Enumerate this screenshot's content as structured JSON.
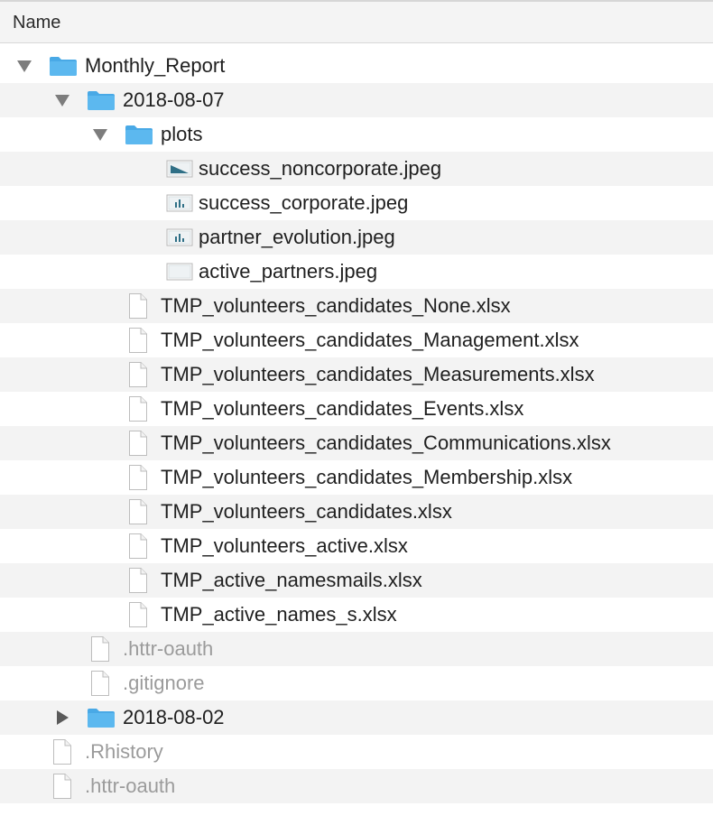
{
  "header": {
    "column_name": "Name"
  },
  "tree": {
    "rows": [
      {
        "label": "Monthly_Report",
        "kind": "folder",
        "depth": 0,
        "expanded": true,
        "icon": "folder-icon",
        "dim": false
      },
      {
        "label": "2018-08-07",
        "kind": "folder",
        "depth": 1,
        "expanded": true,
        "icon": "folder-icon",
        "dim": false
      },
      {
        "label": "plots",
        "kind": "folder",
        "depth": 2,
        "expanded": true,
        "icon": "folder-icon",
        "dim": false
      },
      {
        "label": "success_noncorporate.jpeg",
        "kind": "image",
        "depth": 3,
        "icon": "image-thumbnail-icon",
        "dim": false
      },
      {
        "label": "success_corporate.jpeg",
        "kind": "image",
        "depth": 3,
        "icon": "image-thumbnail-icon",
        "dim": false
      },
      {
        "label": "partner_evolution.jpeg",
        "kind": "image",
        "depth": 3,
        "icon": "image-thumbnail-icon",
        "dim": false
      },
      {
        "label": "active_partners.jpeg",
        "kind": "image",
        "depth": 3,
        "icon": "image-thumbnail-icon",
        "dim": false
      },
      {
        "label": "TMP_volunteers_candidates_None.xlsx",
        "kind": "file",
        "depth": 2,
        "icon": "document-icon",
        "dim": false
      },
      {
        "label": "TMP_volunteers_candidates_Management.xlsx",
        "kind": "file",
        "depth": 2,
        "icon": "document-icon",
        "dim": false
      },
      {
        "label": "TMP_volunteers_candidates_Measurements.xlsx",
        "kind": "file",
        "depth": 2,
        "icon": "document-icon",
        "dim": false
      },
      {
        "label": "TMP_volunteers_candidates_Events.xlsx",
        "kind": "file",
        "depth": 2,
        "icon": "document-icon",
        "dim": false
      },
      {
        "label": "TMP_volunteers_candidates_Communications.xlsx",
        "kind": "file",
        "depth": 2,
        "icon": "document-icon",
        "dim": false
      },
      {
        "label": "TMP_volunteers_candidates_Membership.xlsx",
        "kind": "file",
        "depth": 2,
        "icon": "document-icon",
        "dim": false
      },
      {
        "label": "TMP_volunteers_candidates.xlsx",
        "kind": "file",
        "depth": 2,
        "icon": "document-icon",
        "dim": false
      },
      {
        "label": "TMP_volunteers_active.xlsx",
        "kind": "file",
        "depth": 2,
        "icon": "document-icon",
        "dim": false
      },
      {
        "label": "TMP_active_namesmails.xlsx",
        "kind": "file",
        "depth": 2,
        "icon": "document-icon",
        "dim": false
      },
      {
        "label": "TMP_active_names_s.xlsx",
        "kind": "file",
        "depth": 2,
        "icon": "document-icon",
        "dim": false
      },
      {
        "label": ".httr-oauth",
        "kind": "file",
        "depth": 1,
        "icon": "document-icon",
        "dim": true
      },
      {
        "label": ".gitignore",
        "kind": "file",
        "depth": 1,
        "icon": "document-icon",
        "dim": true
      },
      {
        "label": "2018-08-02",
        "kind": "folder",
        "depth": 1,
        "expanded": false,
        "icon": "folder-icon",
        "dim": false
      },
      {
        "label": ".Rhistory",
        "kind": "file",
        "depth": 0,
        "icon": "document-icon",
        "dim": true
      },
      {
        "label": ".httr-oauth",
        "kind": "file",
        "depth": 0,
        "icon": "document-icon",
        "dim": true
      }
    ]
  },
  "colors": {
    "folder": "#5cb8ef",
    "folder_tab": "#49a9e6",
    "dim_text": "#9b9b9b",
    "stripe": "#f3f3f3"
  }
}
